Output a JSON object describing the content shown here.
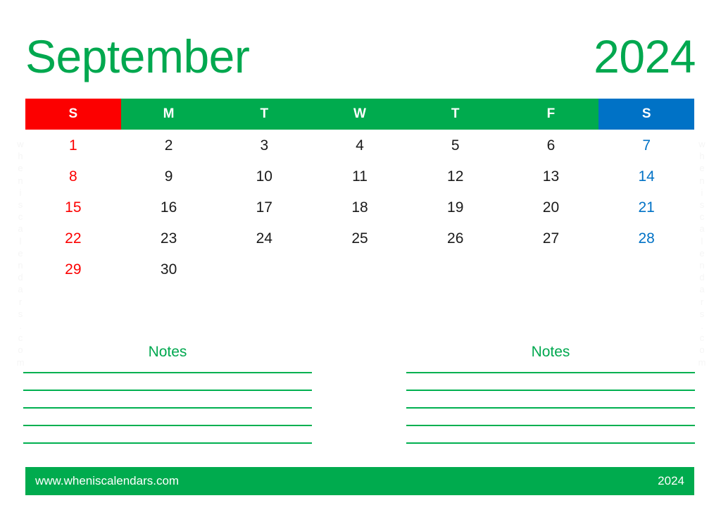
{
  "title": {
    "month": "September",
    "year": "2024"
  },
  "weekdays": [
    {
      "label": "S",
      "kind": "sun"
    },
    {
      "label": "M",
      "kind": "weekday"
    },
    {
      "label": "T",
      "kind": "weekday"
    },
    {
      "label": "W",
      "kind": "weekday"
    },
    {
      "label": "T",
      "kind": "weekday"
    },
    {
      "label": "F",
      "kind": "weekday"
    },
    {
      "label": "S",
      "kind": "sat"
    }
  ],
  "weeks": [
    [
      "1",
      "2",
      "3",
      "4",
      "5",
      "6",
      "7"
    ],
    [
      "8",
      "9",
      "10",
      "11",
      "12",
      "13",
      "14"
    ],
    [
      "15",
      "16",
      "17",
      "18",
      "19",
      "20",
      "21"
    ],
    [
      "22",
      "23",
      "24",
      "25",
      "26",
      "27",
      "28"
    ],
    [
      "29",
      "30",
      "",
      "",
      "",
      "",
      ""
    ]
  ],
  "watermark": {
    "text": "wheniscalendars.com"
  },
  "notes": {
    "left_title": "Notes",
    "right_title": "Notes",
    "line_count": 5
  },
  "footer": {
    "url": "www.wheniscalendars.com",
    "year": "2024"
  },
  "colors": {
    "green": "#00ab4e",
    "title_green": "#00a84f",
    "line_green": "#00b050",
    "sunday_red": "#fc0000",
    "saturday_blue": "#0072c6",
    "text_black": "#1a1a1a",
    "white": "#ffffff",
    "watermark_gray": "#f5f5f5"
  }
}
